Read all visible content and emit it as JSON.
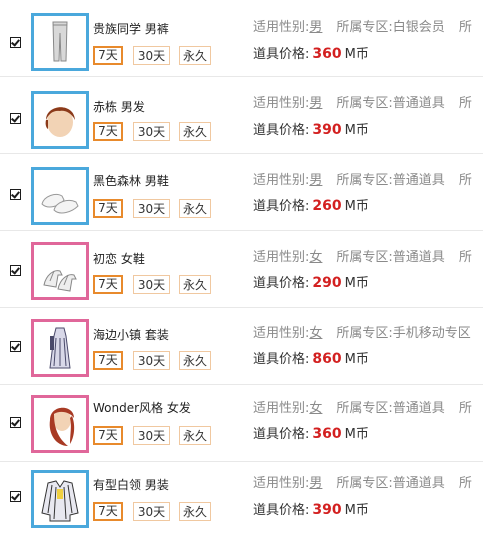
{
  "labels": {
    "gender_prefix": "适用性别:",
    "zone_prefix": "所属专区:",
    "price_prefix": "道具价格:",
    "currency": "M币",
    "trailing": "所"
  },
  "duration_options": [
    "7天",
    "30天",
    "永久"
  ],
  "selected_duration": "7天",
  "items": [
    {
      "name": "贵族同学 男裤",
      "gender": "男",
      "zone": "白银会员",
      "price": "360",
      "checked": true,
      "icon": "pants-icon",
      "thumb_border": "#4aa8dc"
    },
    {
      "name": "赤栋 男发",
      "gender": "男",
      "zone": "普通道具",
      "price": "390",
      "checked": true,
      "icon": "male-hair-icon",
      "thumb_border": "#4aa8dc"
    },
    {
      "name": "黑色森林 男鞋",
      "gender": "男",
      "zone": "普通道具",
      "price": "260",
      "checked": true,
      "icon": "male-shoes-icon",
      "thumb_border": "#4aa8dc"
    },
    {
      "name": "初恋 女鞋",
      "gender": "女",
      "zone": "普通道具",
      "price": "290",
      "checked": true,
      "icon": "female-shoes-icon",
      "thumb_border": "#e0679a"
    },
    {
      "name": "海边小镇 套装",
      "gender": "女",
      "zone": "手机移动专区",
      "price": "860",
      "checked": true,
      "icon": "dress-icon",
      "thumb_border": "#e0679a"
    },
    {
      "name": "Wonder风格 女发",
      "gender": "女",
      "zone": "普通道具",
      "price": "360",
      "checked": true,
      "icon": "female-hair-icon",
      "thumb_border": "#e0679a"
    },
    {
      "name": "有型白领 男装",
      "gender": "男",
      "zone": "普通道具",
      "price": "390",
      "checked": true,
      "icon": "jacket-icon",
      "thumb_border": "#4aa8dc"
    }
  ],
  "colors": {
    "price_red": "#d32020",
    "selected_border": "#e88a2c",
    "male_border": "#4aa8dc",
    "female_border": "#e0679a"
  }
}
